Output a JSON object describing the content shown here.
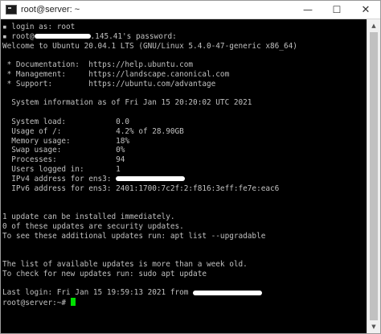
{
  "window": {
    "title": "root@server: ~",
    "controls": {
      "minimize": "—",
      "maximize": "☐",
      "close": "✕"
    }
  },
  "terminal": {
    "prompt": "root@server:~# ",
    "lines": [
      {
        "type": "icon-text",
        "text": "login as: root"
      },
      {
        "type": "icon-redacted",
        "before": "root@",
        "after": ".145.41's password:"
      },
      {
        "type": "text",
        "text": "Welcome to Ubuntu 20.04.1 LTS (GNU/Linux 5.4.0-47-generic x86_64)"
      },
      {
        "type": "blank"
      },
      {
        "type": "text",
        "text": " * Documentation:  https://help.ubuntu.com"
      },
      {
        "type": "text",
        "text": " * Management:     https://landscape.canonical.com"
      },
      {
        "type": "text",
        "text": " * Support:        https://ubuntu.com/advantage"
      },
      {
        "type": "blank"
      },
      {
        "type": "text",
        "text": "  System information as of Fri Jan 15 20:20:02 UTC 2021"
      },
      {
        "type": "blank"
      },
      {
        "type": "text",
        "text": "  System load:           0.0"
      },
      {
        "type": "text",
        "text": "  Usage of /:            4.2% of 28.90GB"
      },
      {
        "type": "text",
        "text": "  Memory usage:          18%"
      },
      {
        "type": "text",
        "text": "  Swap usage:            0%"
      },
      {
        "type": "text",
        "text": "  Processes:             94"
      },
      {
        "type": "text",
        "text": "  Users logged in:       1"
      },
      {
        "type": "redacted",
        "before": "  IPv4 address for ens3: ",
        "after": ""
      },
      {
        "type": "text",
        "text": "  IPv6 address for ens3: 2401:1700:7c2f:2:f816:3eff:fe7e:eac6"
      },
      {
        "type": "blank"
      },
      {
        "type": "blank"
      },
      {
        "type": "text",
        "text": "1 update can be installed immediately."
      },
      {
        "type": "text",
        "text": "0 of these updates are security updates."
      },
      {
        "type": "text",
        "text": "To see these additional updates run: apt list --upgradable"
      },
      {
        "type": "blank"
      },
      {
        "type": "blank"
      },
      {
        "type": "text",
        "text": "The list of available updates is more than a week old."
      },
      {
        "type": "text",
        "text": "To check for new updates run: sudo apt update"
      },
      {
        "type": "blank"
      },
      {
        "type": "redacted",
        "before": "Last login: Fri Jan 15 19:59:13 2021 from ",
        "after": ""
      },
      {
        "type": "prompt"
      }
    ]
  },
  "colors": {
    "terminal_bg": "#000000",
    "terminal_fg": "#c0c0c0",
    "cursor": "#00e000"
  }
}
